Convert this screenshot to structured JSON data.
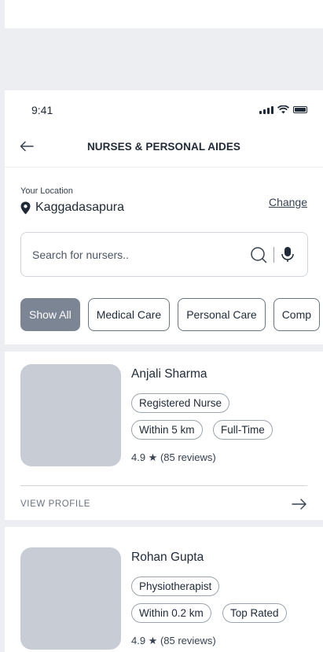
{
  "status": {
    "time": "9:41"
  },
  "header": {
    "title": "NURSES & PERSONAL AIDES"
  },
  "location": {
    "label": "Your Location",
    "name": "Kaggadasapura",
    "change_label": "Change"
  },
  "search": {
    "placeholder": "Search for nursers.."
  },
  "filters": [
    "Show All",
    "Medical Care",
    "Personal Care",
    "Comp"
  ],
  "providers": [
    {
      "name": "Anjali Sharma",
      "tags": [
        "Registered Nurse",
        "Within 5 km",
        "Full-Time"
      ],
      "rating": "4.9 ★ (85 reviews)",
      "cta": "VIEW PROFILE"
    },
    {
      "name": "Rohan Gupta",
      "tags": [
        "Physiotherapist",
        "Within 0.2 km",
        "Top Rated"
      ],
      "rating": "4.9 ★ (85 reviews)"
    }
  ],
  "colors": {
    "accent_chip": "#7c8594",
    "placeholder_image": "#c8ccd4",
    "divider": "#eceef2"
  }
}
